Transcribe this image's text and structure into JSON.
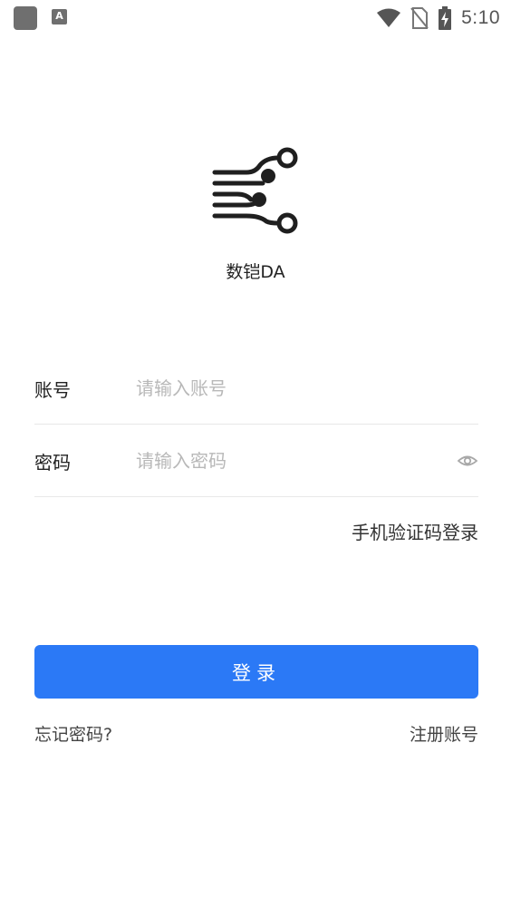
{
  "status_bar": {
    "notification_icon": "A",
    "time": "5:10",
    "icons": [
      "wifi-icon",
      "no-sim-icon",
      "battery-charging-icon"
    ]
  },
  "app": {
    "name": "数铠DA",
    "logo_icon": "circuit-lines-logo"
  },
  "form": {
    "account_label": "账号",
    "account_placeholder": "请输入账号",
    "account_value": "",
    "password_label": "密码",
    "password_placeholder": "请输入密码",
    "password_value": "",
    "password_toggle_icon": "eye-icon",
    "sms_login_label": "手机验证码登录"
  },
  "actions": {
    "login_label": "登录",
    "forgot_label": "忘记密码?",
    "register_label": "注册账号"
  },
  "colors": {
    "primary": "#2b79f6",
    "logo": "#1f1f1f",
    "placeholder": "#b8b8b8",
    "divider": "#e8e8e8"
  }
}
